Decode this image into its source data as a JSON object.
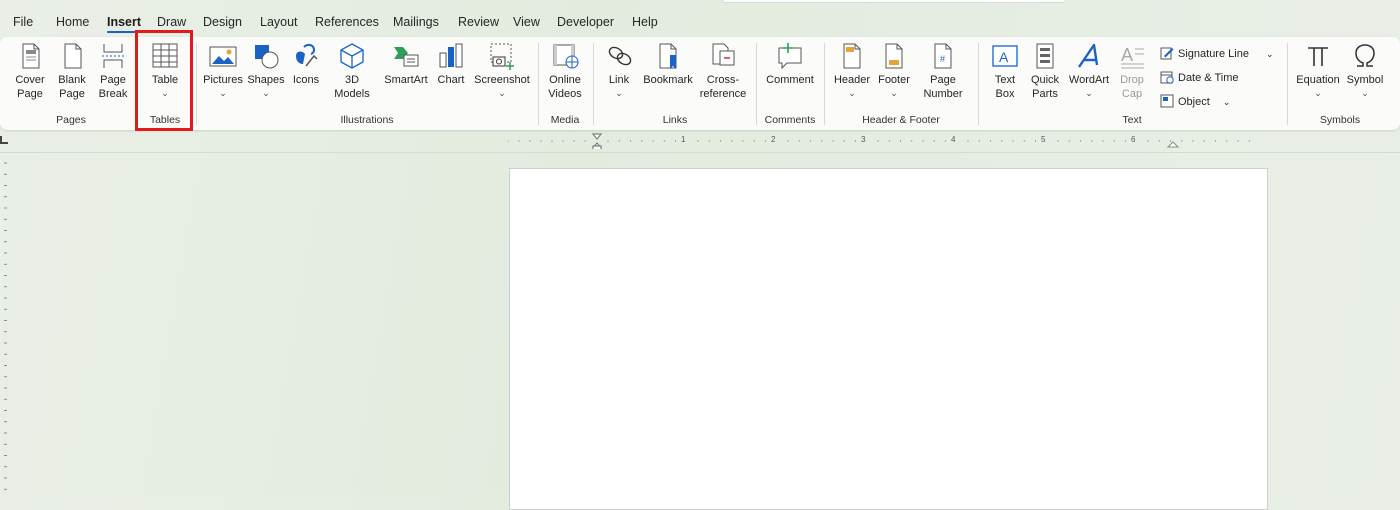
{
  "tabs": [
    "File",
    "Home",
    "Insert",
    "Draw",
    "Design",
    "Layout",
    "References",
    "Mailings",
    "Review",
    "View",
    "Developer",
    "Help"
  ],
  "active_tab": "Insert",
  "ribbon": {
    "pages": {
      "cover_label": "Cover\nPage",
      "blank_label": "Blank\nPage",
      "break_label": "Page\nBreak",
      "group": "Pages"
    },
    "tables": {
      "table_label": "Table",
      "group": "Tables"
    },
    "illustrations": {
      "pictures": "Pictures",
      "shapes": "Shapes",
      "icons": "Icons",
      "models": "3D\nModels",
      "smartart": "SmartArt",
      "chart": "Chart",
      "screenshot": "Screenshot",
      "group": "Illustrations"
    },
    "media": {
      "online_videos": "Online\nVideos",
      "group": "Media"
    },
    "links": {
      "link": "Link",
      "bookmark": "Bookmark",
      "cross_ref": "Cross-\nreference",
      "group": "Links"
    },
    "comments": {
      "comment": "Comment",
      "group": "Comments"
    },
    "header_footer": {
      "header": "Header",
      "footer": "Footer",
      "page_number": "Page\nNumber",
      "group": "Header & Footer"
    },
    "text": {
      "text_box": "Text\nBox",
      "quick_parts": "Quick\nParts",
      "wordart": "WordArt",
      "drop_cap": "Drop\nCap",
      "signature_line": "Signature Line",
      "date_time": "Date & Time",
      "object": "Object",
      "group": "Text"
    },
    "symbols": {
      "equation": "Equation",
      "symbol": "Symbol",
      "group": "Symbols"
    }
  },
  "ruler": {
    "numbers": [
      "1",
      "2",
      "3",
      "4",
      "5",
      "6"
    ]
  },
  "colors": {
    "accent": "#1a62c4",
    "highlight": "#e01b1b"
  }
}
